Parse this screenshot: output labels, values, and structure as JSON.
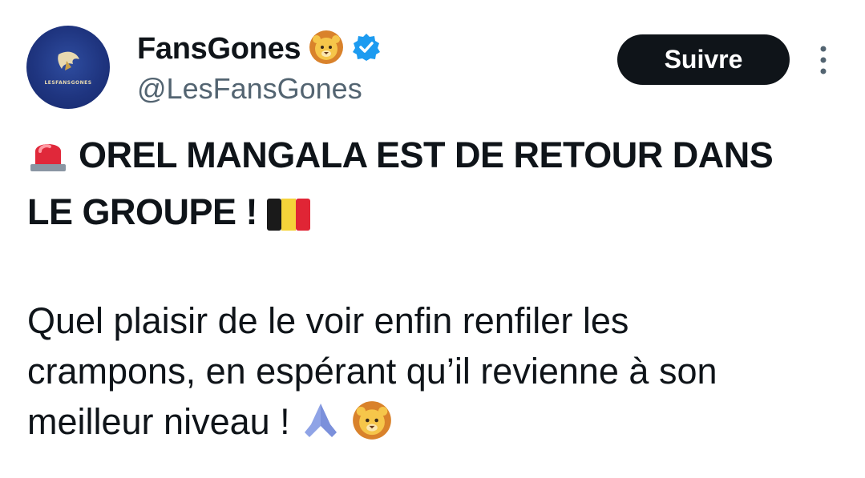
{
  "account": {
    "display_name": "FansGones",
    "handle": "@LesFansGones",
    "avatar_text": "LESFANSGONES",
    "verified_color": "#1d9bf0"
  },
  "actions": {
    "follow_label": "Suivre"
  },
  "tweet": {
    "headline_line1": "OREL MANGALA EST DE RETOUR DANS",
    "headline_line2": "LE GROUPE !",
    "body_line1": "Quel plaisir de le voir enfin renfiler les",
    "body_line2": "crampons, en espérant qu’il revienne à son",
    "body_line3": "meilleur niveau !"
  },
  "colors": {
    "text": "#0f1419",
    "secondary": "#536471",
    "button_bg": "#0f1419"
  },
  "icons": [
    "lion-emoji-icon",
    "verified-badge-icon",
    "more-options-icon",
    "siren-emoji-icon",
    "belgium-flag-icon",
    "praying-hands-icon"
  ]
}
